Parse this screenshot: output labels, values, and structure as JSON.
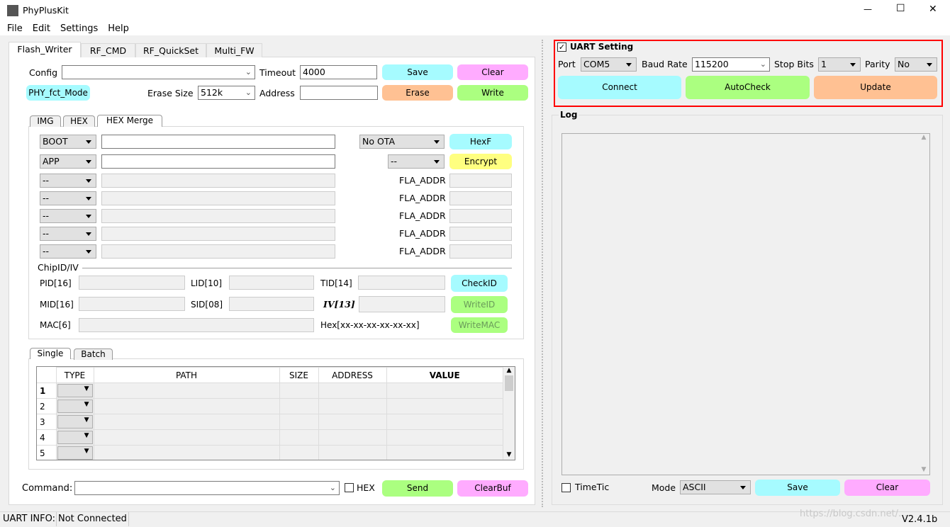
{
  "window": {
    "title": "PhyPlusKit",
    "minimize": "—",
    "maximize": "☐",
    "close": "✕"
  },
  "menu": [
    "File",
    "Edit",
    "Settings",
    "Help"
  ],
  "main_tabs": [
    "Flash_Writer",
    "RF_CMD",
    "RF_QuickSet",
    "Multi_FW"
  ],
  "flash": {
    "config_label": "Config",
    "config_value": "",
    "timeout_label": "Timeout",
    "timeout_value": "4000",
    "save": "Save",
    "clear": "Clear",
    "fct_mode": "PHY_fct_Mode",
    "erase_size_label": "Erase Size",
    "erase_size_value": "512k",
    "address_label": "Address",
    "address_value": "",
    "erase": "Erase",
    "write": "Write"
  },
  "sub_tabs": [
    "IMG",
    "HEX",
    "HEX Merge"
  ],
  "merge": {
    "rows": [
      {
        "type": "BOOT",
        "path": ""
      },
      {
        "type": "APP",
        "path": ""
      },
      {
        "type": "--",
        "path": ""
      },
      {
        "type": "--",
        "path": ""
      },
      {
        "type": "--",
        "path": ""
      },
      {
        "type": "--",
        "path": ""
      },
      {
        "type": "--",
        "path": ""
      }
    ],
    "ota_value": "No OTA",
    "hexf": "HexF",
    "enc_value": "--",
    "encrypt": "Encrypt",
    "fla_addr_label": "FLA_ADDR"
  },
  "chipid": {
    "title": "ChipID/IV",
    "pid": "PID[16]",
    "lid": "LID[10]",
    "tid": "TID[14]",
    "mid": "MID[16]",
    "sid": "SID[08]",
    "iv": "IV[13]",
    "mac": "MAC[6]",
    "hex_hint": "Hex[xx-xx-xx-xx-xx-xx]",
    "check_id": "CheckID",
    "write_id": "WriteID",
    "write_mac": "WriteMAC"
  },
  "mode_tabs": [
    "Single",
    "Batch"
  ],
  "table": {
    "columns": [
      "TYPE",
      "PATH",
      "SIZE",
      "ADDRESS",
      "VALUE"
    ],
    "rows": [
      "1",
      "2",
      "3",
      "4",
      "5"
    ]
  },
  "command": {
    "label": "Command:",
    "value": "",
    "hex_label": "HEX",
    "hex_checked": false,
    "send": "Send",
    "clearbuf": "ClearBuf"
  },
  "status": {
    "label": "UART INFO:",
    "value": "Not Connected",
    "version": "V2.4.1b"
  },
  "uart": {
    "title": "UART Setting",
    "enabled": true,
    "port_label": "Port",
    "port": "COM5",
    "baud_label": "Baud Rate",
    "baud": "115200",
    "stop_label": "Stop Bits",
    "stop": "1",
    "parity_label": "Parity",
    "parity": "No",
    "connect": "Connect",
    "autocheck": "AutoCheck",
    "update": "Update",
    "highlight_color": "#ff0000"
  },
  "log": {
    "title": "Log",
    "content": "",
    "timetic_label": "TimeTic",
    "timetic_checked": false,
    "mode_label": "Mode",
    "mode": "ASCII",
    "save": "Save",
    "clear": "Clear"
  },
  "watermark": "https://blog.csdn.net/..."
}
